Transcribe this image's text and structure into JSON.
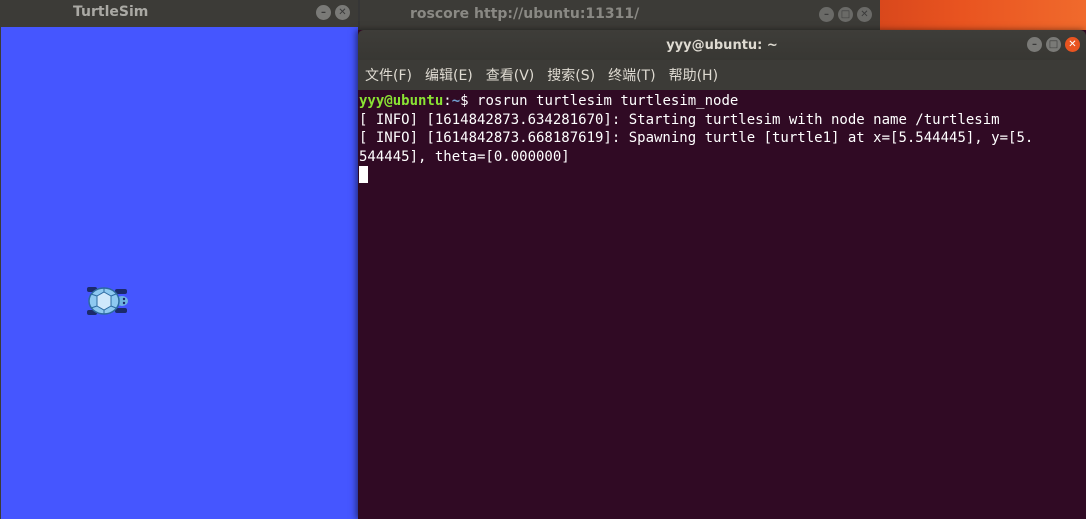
{
  "turtlesim": {
    "title": "TurtleSim",
    "background_color": "#4556ff",
    "turtle_icon": "turtle-icon"
  },
  "roscore": {
    "title": "roscore http://ubuntu:11311/"
  },
  "terminal": {
    "title": "yyy@ubuntu: ~",
    "menu": [
      "文件(F)",
      "编辑(E)",
      "查看(V)",
      "搜索(S)",
      "终端(T)",
      "帮助(H)"
    ],
    "prompt_user": "yyy@ubuntu",
    "prompt_sep": ":",
    "prompt_path": "~",
    "prompt_symbol": "$ ",
    "command": "rosrun turtlesim turtlesim_node",
    "output_lines": [
      "[ INFO] [1614842873.634281670]: Starting turtlesim with node name /turtlesim",
      "[ INFO] [1614842873.668187619]: Spawning turtle [turtle1] at x=[5.544445], y=[5.",
      "544445], theta=[0.000000]"
    ],
    "background_color": "#300a24",
    "prompt_user_color": "#8ae234",
    "prompt_path_color": "#729fcf"
  },
  "window_controls": {
    "minimize": "minimize-icon",
    "maximize": "maximize-icon",
    "close": "close-icon"
  }
}
